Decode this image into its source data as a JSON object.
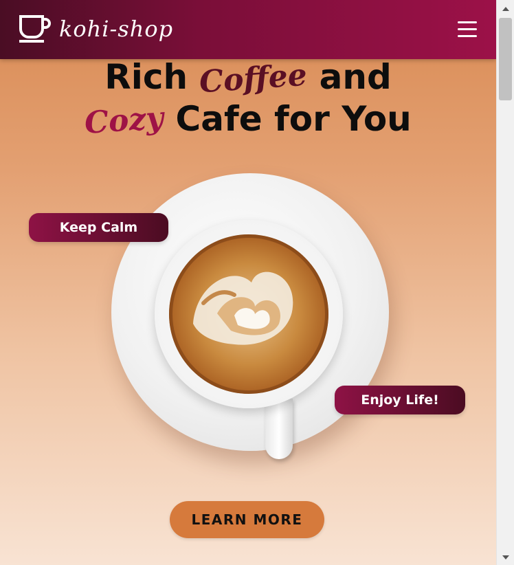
{
  "header": {
    "brand_name": "kohi-shop",
    "logo_icon": "coffee-cup-icon",
    "menu_icon": "hamburger-menu-icon"
  },
  "hero": {
    "line1_before": "Rich ",
    "line1_script": "Coffee",
    "line1_after": " and",
    "line2_script": "Cozy",
    "line2_after": " Cafe for You",
    "badge_left": "Keep Calm",
    "badge_right": "Enjoy Life!",
    "cta_label": "LEARN MORE",
    "image": "latte-art-coffee-cup"
  },
  "colors": {
    "header_start": "#4a0d24",
    "header_end": "#9c1148",
    "accent_orange": "#d67a3c",
    "script_dark": "#5a0f24",
    "script_pink": "#9e1246"
  }
}
